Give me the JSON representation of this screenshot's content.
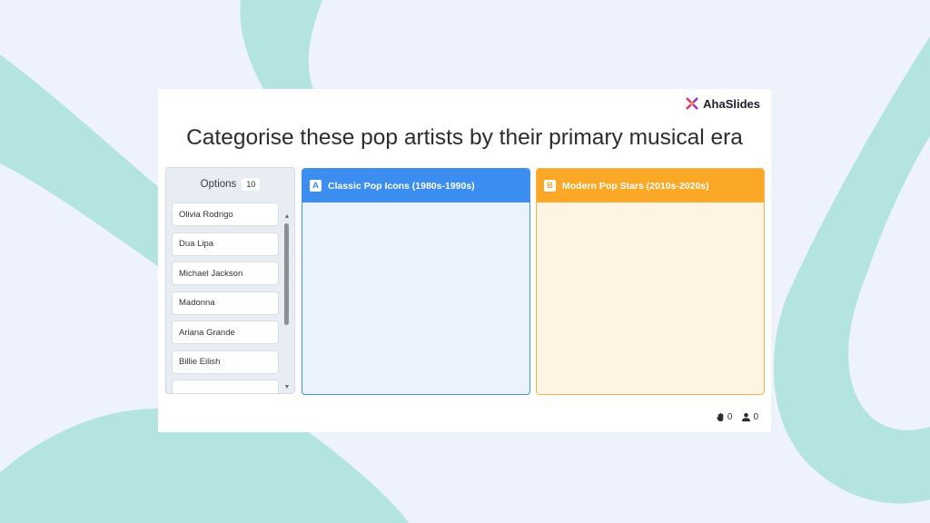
{
  "brand": {
    "name": "AhaSlides"
  },
  "colors": {
    "background": "#eef2fc",
    "decor": "#b3e4e0",
    "category_a": "#3b8ef0",
    "category_b": "#fba826"
  },
  "question": {
    "title": "Categorise these pop artists by their primary musical era"
  },
  "options": {
    "label": "Options",
    "count": "10",
    "items": [
      "Olivia Rodrigo",
      "Dua Lipa",
      "Michael Jackson",
      "Madonna",
      "Ariana Grande",
      "Billie Eilish",
      ""
    ]
  },
  "categories": [
    {
      "letter": "A",
      "title": "Classic Pop Icons (1980s-1990s)"
    },
    {
      "letter": "B",
      "title": "Modern Pop Stars (2010s-2020s)"
    }
  ],
  "stats": {
    "reactions": "0",
    "participants": "0",
    "reaction_icon": "hand-icon",
    "participant_icon": "user-icon"
  }
}
